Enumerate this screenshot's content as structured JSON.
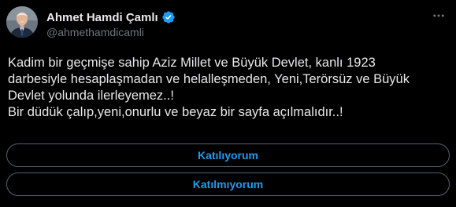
{
  "author": {
    "display_name": "Ahmet Hamdi Çamlı",
    "handle": "@ahmethamdicamli"
  },
  "tweet": {
    "lines": [
      "Kadim bir geçmişe sahip Aziz Millet  ve Büyük Devlet, kanlı 1923",
      "darbesiyle hesaplaşmadan ve helalleşmeden, Yeni,Terörsüz ve Büyük",
      "Devlet yolunda ilerleyemez..!",
      "Bir düdük çalıp,yeni,onurlu ve beyaz bir sayfa açılmalıdır..!"
    ]
  },
  "poll": {
    "options": [
      {
        "label": "Katılıyorum"
      },
      {
        "label": "Katılmıyorum"
      }
    ]
  },
  "icons": {
    "verified": "verified-badge-icon",
    "more": "more-options-icon"
  },
  "colors": {
    "background": "#000000",
    "text": "#e7e9ea",
    "secondary": "#71767b",
    "accent": "#1d9bf0",
    "border": "#536471"
  }
}
